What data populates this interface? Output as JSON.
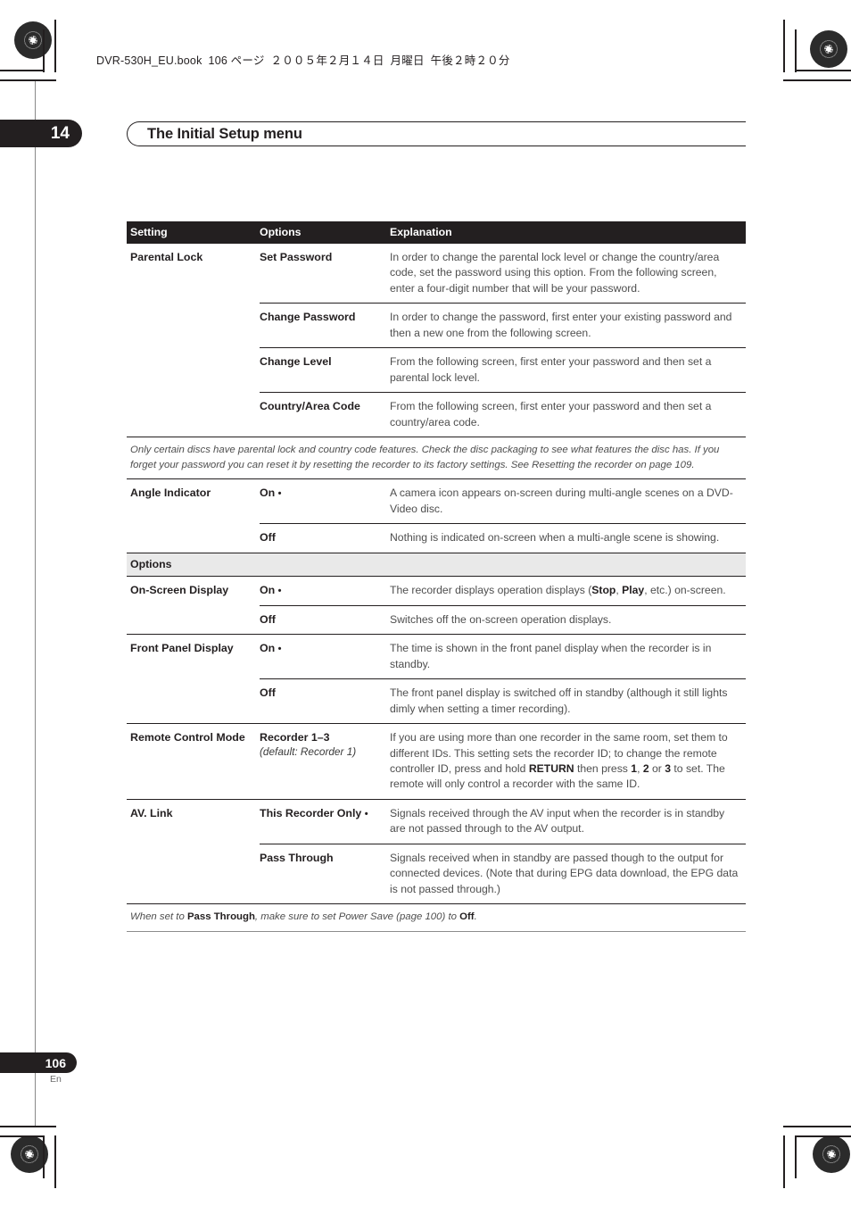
{
  "book_header": {
    "filename": "DVR-530H_EU.book",
    "page_label": "106 ページ",
    "date": "２００５年２月１４日",
    "weekday": "月曜日",
    "time": "午後２時２０分"
  },
  "chapter": {
    "number": "14",
    "title": "The Initial Setup menu"
  },
  "page_footer": {
    "number": "106",
    "language": "En"
  },
  "colors": {
    "ink": "#231f20",
    "band": "#e9e9e9",
    "body_text": "#4e4e4e"
  },
  "table": {
    "headers": {
      "setting": "Setting",
      "options": "Options",
      "explanation": "Explanation"
    },
    "rows": [
      {
        "setting": "Parental Lock",
        "option": "Set Password",
        "option_sub": "",
        "explanation_html": "In order to change the parental lock level or change the country/area code, set the password using this option. From the following screen, enter a four-digit number that will be your password."
      },
      {
        "setting": "",
        "option": "Change Password",
        "option_sub": "",
        "explanation_html": "In order to change the password, first enter your existing password and then a new one from the following screen."
      },
      {
        "setting": "",
        "option": "Change Level",
        "option_sub": "",
        "explanation_html": "From the following screen, first enter your password and then set a parental lock level."
      },
      {
        "setting": "",
        "option": "Country/Area Code",
        "option_sub": "",
        "explanation_html": "From the following screen, first enter your password and then set a country/area code."
      }
    ],
    "note_1_html": "Only certain discs have parental lock and country code features. Check the disc packaging to see what features the disc has. If you forget your password you can reset it by resetting the recorder to its factory settings. See Resetting the recorder on page 109.",
    "rows_angle": [
      {
        "setting": "Angle Indicator",
        "option": "On",
        "default_bullet": "•",
        "explanation_html": "A camera icon appears on-screen during multi-angle scenes on a DVD-Video disc."
      },
      {
        "setting": "",
        "option": "Off",
        "default_bullet": "",
        "explanation_html": "Nothing is indicated on-screen when a multi-angle scene is showing."
      }
    ],
    "section_band": "Options",
    "rows_options": [
      {
        "setting": "On-Screen Display",
        "option": "On",
        "default_bullet": "•",
        "option_sub": "",
        "explanation_html": "The recorder displays operation displays (<b>Stop</b>, <b>Play</b>, etc.) on-screen."
      },
      {
        "setting": "",
        "option": "Off",
        "default_bullet": "",
        "option_sub": "",
        "explanation_html": "Switches off the on-screen operation displays."
      },
      {
        "setting": "Front Panel Display",
        "option": "On",
        "default_bullet": "•",
        "option_sub": "",
        "explanation_html": "The time is shown in the front panel display when the recorder is in standby."
      },
      {
        "setting": "",
        "option": "Off",
        "default_bullet": "",
        "option_sub": "",
        "explanation_html": "The front panel display is switched off in standby (although it still lights dimly when setting a timer recording)."
      },
      {
        "setting": "Remote Control Mode",
        "option": "Recorder 1–3",
        "default_bullet": "",
        "option_sub": "(default: Recorder 1)",
        "explanation_html": "If you are using more than one recorder in the same room, set them to different IDs. This setting sets the recorder ID; to change the remote controller ID, press and hold <b>RETURN</b> then press <b>1</b>, <b>2</b> or <b>3</b> to set. The remote will only control a recorder with the same ID."
      },
      {
        "setting": "AV. Link",
        "option": "This Recorder Only",
        "default_bullet": "•",
        "option_sub": "",
        "explanation_html": "Signals received through the AV input when the recorder is in standby are not passed through to the AV output."
      },
      {
        "setting": "",
        "option": "Pass Through",
        "default_bullet": "",
        "option_sub": "",
        "explanation_html": "Signals received when in standby are passed though to the output for connected devices. (Note that during EPG data download, the EPG data is not passed through.)"
      }
    ],
    "note_2_html": "When set to <b>Pass Through</b>, make sure to set Power Save (page 100) to <b>Off</b>."
  }
}
